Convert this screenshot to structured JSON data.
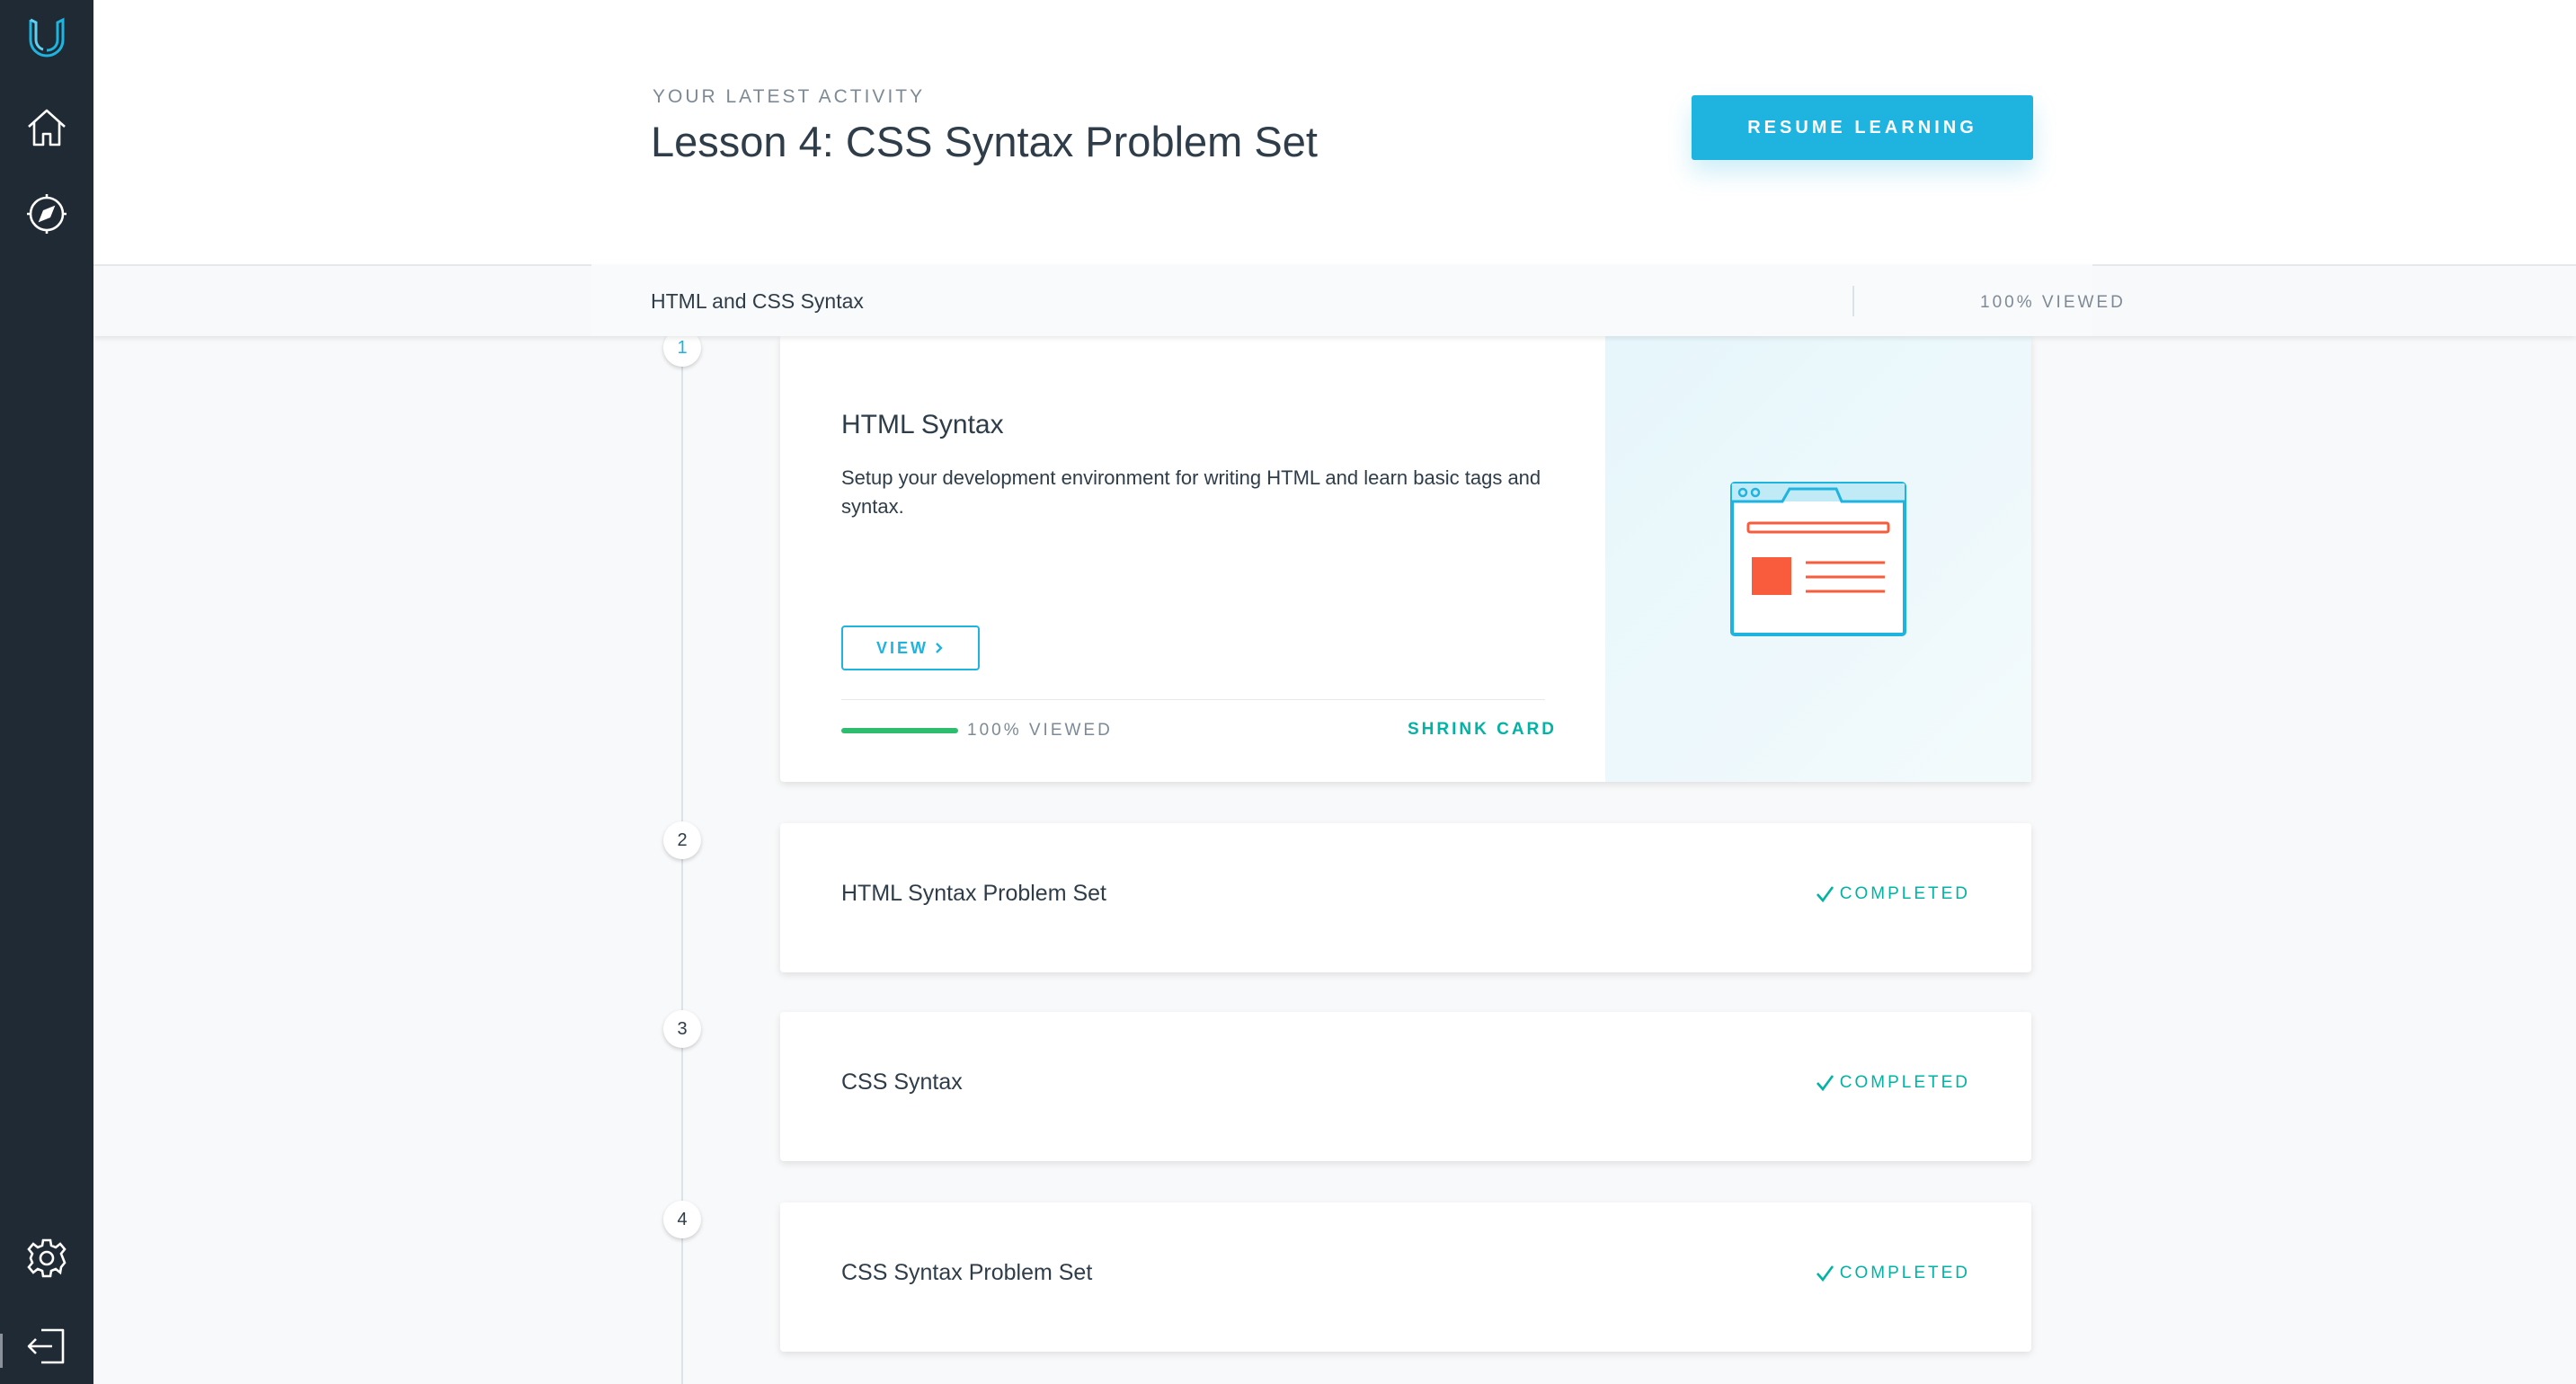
{
  "sidebar": {
    "logo": "udacity-logo-icon",
    "items": [
      {
        "icon": "home-icon"
      },
      {
        "icon": "compass-icon"
      },
      {
        "icon": "gear-icon"
      },
      {
        "icon": "logout-icon"
      }
    ]
  },
  "header": {
    "label": "YOUR LATEST ACTIVITY",
    "title": "Lesson 4: CSS Syntax Problem Set",
    "resume_button": "RESUME LEARNING"
  },
  "section": {
    "title": "HTML and CSS Syntax",
    "progress": "100% VIEWED"
  },
  "lessons": [
    {
      "number": "1",
      "title": "HTML Syntax",
      "description": "Setup your development environment for writing HTML and learn basic tags and syntax.",
      "view_button": "VIEW",
      "progress_text": "100% VIEWED",
      "progress_fraction": 1.0,
      "shrink_label": "SHRINK CARD",
      "art_icon": "browser-window-illustration"
    },
    {
      "number": "2",
      "title": "HTML Syntax Problem Set",
      "status": "COMPLETED"
    },
    {
      "number": "3",
      "title": "CSS Syntax",
      "status": "COMPLETED"
    },
    {
      "number": "4",
      "title": "CSS Syntax Problem Set",
      "status": "COMPLETED"
    }
  ],
  "colors": {
    "sidebar": "#1f2a35",
    "accent": "#1fb3e0",
    "success": "#02b3a4",
    "progress_green": "#2ebd6e",
    "illustration_red": "#f95c3c"
  }
}
